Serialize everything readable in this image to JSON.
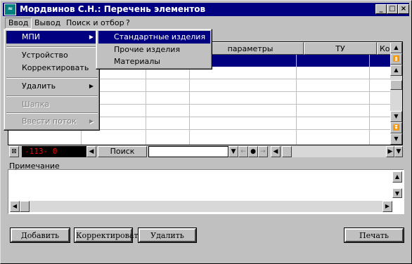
{
  "window": {
    "title": "Мордвинов С.Н.: Перечень элементов",
    "icon": "app-icon",
    "minimize": "_",
    "maximize": "□",
    "close": "×"
  },
  "menubar": {
    "items": [
      "Ввод",
      "Вывод",
      "Поиск и отбор",
      "?"
    ]
  },
  "menu_vvod": {
    "items": [
      {
        "label": "МПИ",
        "submenu": true
      },
      {
        "label": "Устройство"
      },
      {
        "label": "Корректировать"
      },
      {
        "label": "Удалить",
        "submenu": true
      },
      {
        "label": "Шапка",
        "disabled": true
      },
      {
        "label": "Ввести поток",
        "submenu": true,
        "disabled": true
      }
    ]
  },
  "submenu_mpi": {
    "items": [
      "Стандартные изделия",
      "Прочие изделия",
      "Материалы"
    ]
  },
  "grid": {
    "columns": [
      "параметры",
      "ТУ",
      "Кол"
    ]
  },
  "nav": {
    "counter": "-113-  0",
    "search_label": "Поиск",
    "search_value": ""
  },
  "notes": {
    "label": "Примечание",
    "value": ""
  },
  "buttons": {
    "add": "Добавить",
    "edit": "Корректировать",
    "delete": "Удалить",
    "print": "Печать"
  },
  "colors": {
    "selection": "#000080",
    "counter_text": "#ff0000",
    "face": "#c0c0c0"
  }
}
